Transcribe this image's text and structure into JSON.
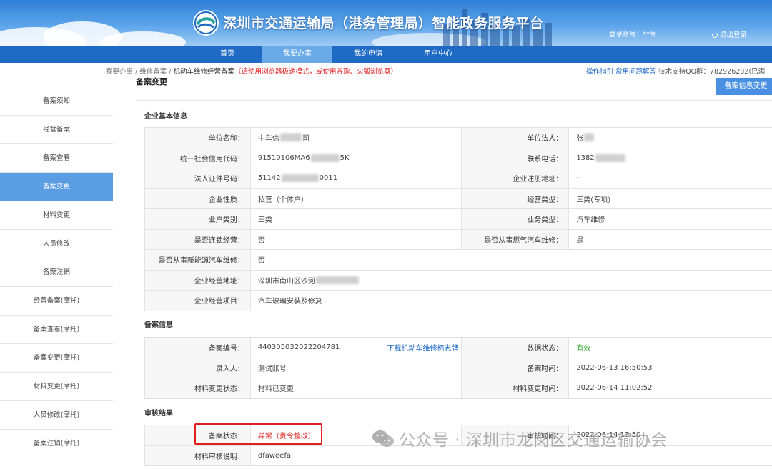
{
  "header": {
    "title": "深圳市交通运输局（港务管理局）智能政务服务平台",
    "login_account": "登录账号：**号",
    "logout": "退出登录"
  },
  "nav": [
    "首页",
    "我要办事",
    "我的申请",
    "用户中心"
  ],
  "breadcrumb": {
    "parts": "我要办事 / 维修备案 / ",
    "current": "机动车维修经营备案",
    "warning": "（请使用浏览器极速模式，或使用谷歌、火狐浏览器）"
  },
  "help": {
    "guide": "操作指引",
    "faq": "常用问题解答",
    "support": "技术支持QQ群：782926232(已满"
  },
  "sidebar": [
    "备案须知",
    "经营备案",
    "备案查看",
    "备案变更",
    "材料变更",
    "人员修改",
    "备案注销",
    "经营备案(摩托)",
    "备案查看(摩托)",
    "备案变更(摩托)",
    "材料变更(摩托)",
    "人员修改(摩托)",
    "备案注销(摩托)"
  ],
  "main": {
    "title": "备案变更",
    "action_button": "备案信息变更"
  },
  "enterprise": {
    "title": "企业基本信息",
    "unit_name_label": "单位名称：",
    "unit_name_a": "中车信",
    "unit_name_b": "司",
    "legal_person_label": "单位法人：",
    "legal_person": "张",
    "credit_code_label": "统一社会信用代码：",
    "credit_code_a": "91510106MA6",
    "credit_code_b": "5K",
    "phone_label": "联系电话：",
    "phone": "1382",
    "id_no_label": "法人证件号码：",
    "id_no_a": "51142",
    "id_no_b": "0011",
    "reg_addr_label": "企业注册地址：",
    "reg_addr": "-",
    "nature_label": "企业性质：",
    "nature": "私营（个体户）",
    "biz_type_label": "经营类型：",
    "biz_type": "三类(专项)",
    "category_label": "业户类别：",
    "category": "三类",
    "service_type_label": "业务类型：",
    "service_type": "汽车维修",
    "chain_label": "是否连锁经营：",
    "chain": "否",
    "gas_label": "是否从事燃气汽车维修：",
    "gas": "是",
    "ev_label": "是否从事新能源汽车维修：",
    "ev": "否",
    "address_label": "企业经营地址：",
    "address": "深圳市南山区沙河",
    "project_label": "企业经营项目：",
    "project": "汽车玻璃安装及修复"
  },
  "record": {
    "title": "备案信息",
    "no_label": "备案编号：",
    "no": "440305032022204781",
    "download_link": "下载机动车维修标志牌",
    "status_label": "数据状态：",
    "status": "有效",
    "recorder_label": "录入人：",
    "recorder": "测试账号",
    "time_label": "备案时间：",
    "time": "2022-06-13 16:50:53",
    "mat_status_label": "材料变更状态：",
    "mat_status": "材料已变更",
    "mat_time_label": "材料变更时间：",
    "mat_time": "2022-06-14 11:02:52"
  },
  "review": {
    "title": "审核结果",
    "status_label": "备案状态：",
    "status": "异常（责令整改）",
    "time_label": "审核时间：",
    "time": "2022-06-14 13:50",
    "note_label": "材料审核说明：",
    "note": "dfaweefa"
  },
  "watermark": "公众号 · 深圳市龙岗区交通运输协会",
  "colors": {
    "nav": "#1f6ac4",
    "active": "#5b9de3",
    "danger": "#e02020",
    "ok": "#2aa72a",
    "link": "#1a64c8"
  }
}
